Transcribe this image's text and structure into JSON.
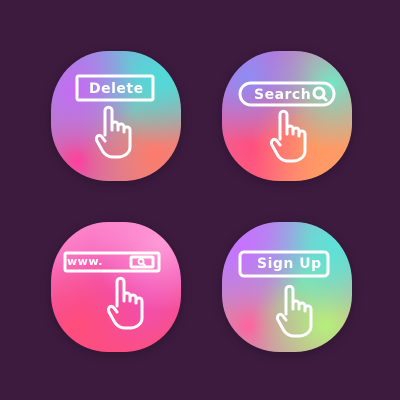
{
  "tiles": [
    {
      "name": "delete",
      "label": "Delete"
    },
    {
      "name": "search",
      "label": "Search"
    },
    {
      "name": "url",
      "label": "www."
    },
    {
      "name": "signup",
      "label": "Sign Up"
    }
  ],
  "icons": {
    "search": "magnifier-icon",
    "hand": "pointing-hand-icon"
  }
}
